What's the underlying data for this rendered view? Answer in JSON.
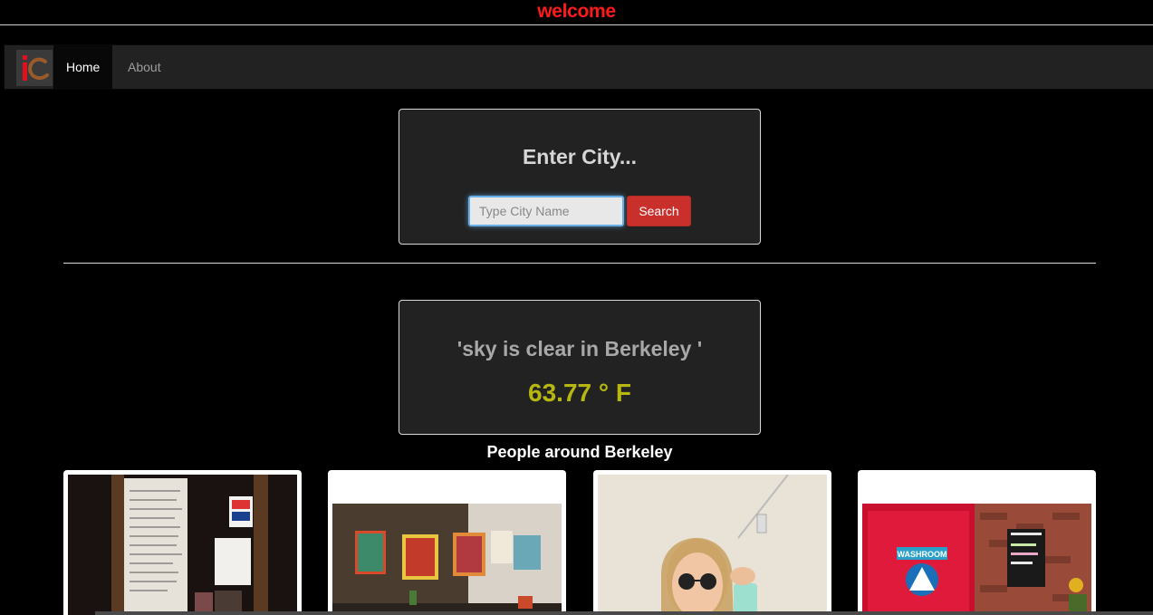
{
  "header": {
    "welcome": "welcome"
  },
  "nav": {
    "items": [
      {
        "label": "Home",
        "active": true
      },
      {
        "label": "About",
        "active": false
      }
    ]
  },
  "search": {
    "heading": "Enter City...",
    "placeholder": "Type City Name",
    "value": "",
    "button_label": "Search"
  },
  "weather": {
    "description": "'sky is clear in Berkeley '",
    "temperature": "63.77 ° F"
  },
  "people": {
    "heading": "People around Berkeley",
    "photos": [
      {
        "icon": "handwritten-notice-photo"
      },
      {
        "icon": "cafe-wall-art-photo"
      },
      {
        "icon": "selfie-photo"
      },
      {
        "icon": "washroom-door-photo"
      }
    ]
  },
  "colors": {
    "welcome": "#ff1a1a",
    "accent_button": "#c9302c",
    "temperature": "#b7b80f",
    "panel_bg": "#222222"
  }
}
